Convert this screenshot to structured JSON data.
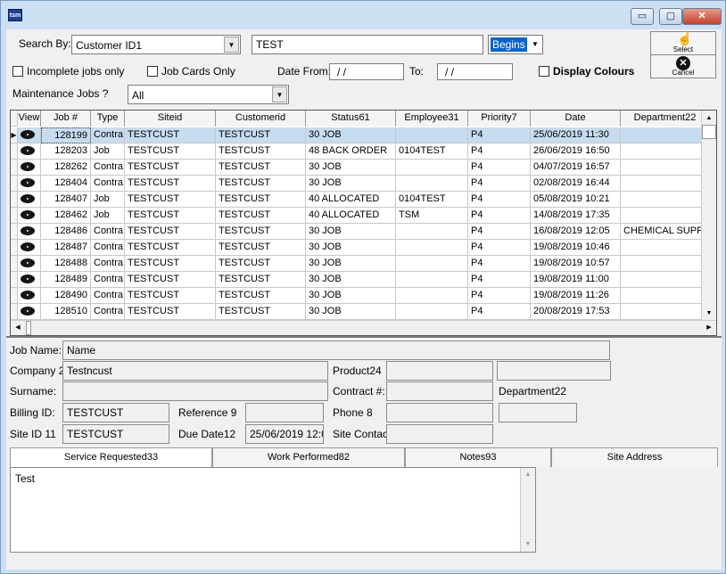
{
  "window": {
    "icon_text": "tsm",
    "minimize": "▭",
    "maximize": "▢",
    "close": "✕"
  },
  "search": {
    "by_label": "Search By:",
    "by_value": "Customer ID1",
    "term": "TEST",
    "mode": "Begins",
    "incomplete_label": "Incomplete jobs only",
    "jobcards_label": "Job Cards Only",
    "date_from_label": "Date From:",
    "date_from_value": "/  /",
    "to_label": "To:",
    "to_value": "/  /",
    "display_colours_label": "Display Colours",
    "maintenance_label": "Maintenance Jobs ?",
    "maintenance_value": "All",
    "select_label": "Select",
    "cancel_label": "Cancel"
  },
  "grid": {
    "columns": [
      "View",
      "Job #",
      "Type",
      "Siteid",
      "Customerid",
      "Status61",
      "Employee31",
      "Priority7",
      "Date",
      "Department22"
    ],
    "rows": [
      {
        "job": "128199",
        "type": "Contra",
        "siteid": "TESTCUST",
        "customerid": "TESTCUST",
        "status": "30 JOB",
        "employee": "",
        "priority": "P4",
        "date": "25/06/2019 11:30",
        "department": ""
      },
      {
        "job": "128203",
        "type": "Job",
        "siteid": "TESTCUST",
        "customerid": "TESTCUST",
        "status": "48 BACK ORDER",
        "employee": "0104TEST",
        "priority": "P4",
        "date": "26/06/2019 16:50",
        "department": ""
      },
      {
        "job": "128262",
        "type": "Contra",
        "siteid": "TESTCUST",
        "customerid": "TESTCUST",
        "status": "30 JOB",
        "employee": "",
        "priority": "P4",
        "date": "04/07/2019 16:57",
        "department": ""
      },
      {
        "job": "128404",
        "type": "Contra",
        "siteid": "TESTCUST",
        "customerid": "TESTCUST",
        "status": "30 JOB",
        "employee": "",
        "priority": "P4",
        "date": "02/08/2019 16:44",
        "department": ""
      },
      {
        "job": "128407",
        "type": "Job",
        "siteid": "TESTCUST",
        "customerid": "TESTCUST",
        "status": "40 ALLOCATED",
        "employee": "0104TEST",
        "priority": "P4",
        "date": "05/08/2019 10:21",
        "department": ""
      },
      {
        "job": "128462",
        "type": "Job",
        "siteid": "TESTCUST",
        "customerid": "TESTCUST",
        "status": "40 ALLOCATED",
        "employee": "TSM",
        "priority": "P4",
        "date": "14/08/2019 17:35",
        "department": ""
      },
      {
        "job": "128486",
        "type": "Contra",
        "siteid": "TESTCUST",
        "customerid": "TESTCUST",
        "status": "30 JOB",
        "employee": "",
        "priority": "P4",
        "date": "16/08/2019 12:05",
        "department": "CHEMICAL SUPP"
      },
      {
        "job": "128487",
        "type": "Contra",
        "siteid": "TESTCUST",
        "customerid": "TESTCUST",
        "status": "30 JOB",
        "employee": "",
        "priority": "P4",
        "date": "19/08/2019 10:46",
        "department": ""
      },
      {
        "job": "128488",
        "type": "Contra",
        "siteid": "TESTCUST",
        "customerid": "TESTCUST",
        "status": "30 JOB",
        "employee": "",
        "priority": "P4",
        "date": "19/08/2019 10:57",
        "department": ""
      },
      {
        "job": "128489",
        "type": "Contra",
        "siteid": "TESTCUST",
        "customerid": "TESTCUST",
        "status": "30 JOB",
        "employee": "",
        "priority": "P4",
        "date": "19/08/2019 11:00",
        "department": ""
      },
      {
        "job": "128490",
        "type": "Contra",
        "siteid": "TESTCUST",
        "customerid": "TESTCUST",
        "status": "30 JOB",
        "employee": "",
        "priority": "P4",
        "date": "19/08/2019 11:26",
        "department": ""
      },
      {
        "job": "128510",
        "type": "Contra",
        "siteid": "TESTCUST",
        "customerid": "TESTCUST",
        "status": "30 JOB",
        "employee": "",
        "priority": "P4",
        "date": "20/08/2019 17:53",
        "department": ""
      }
    ]
  },
  "detail": {
    "job_name_label": "Job Name:",
    "job_name_value": "Name",
    "company_label": "Company 2",
    "company_value": "Testncust",
    "product_label": "Product24",
    "product_value": "",
    "product_value2": "",
    "surname_label": "Surname:",
    "surname_value": "",
    "contract_label": "Contract #:",
    "contract_value": "",
    "department_label": "Department22",
    "billing_label": "Billing ID:",
    "billing_value": "TESTCUST",
    "reference_label": "Reference 9",
    "reference_value": "",
    "phone_label": "Phone 8",
    "phone_value": "",
    "phone_value2": "",
    "siteid_label": "Site ID 11",
    "siteid_value": "TESTCUST",
    "duedate_label": "Due Date12",
    "duedate_value": "25/06/2019 12:0",
    "sitecontact_label": "Site Contac",
    "sitecontact_value": ""
  },
  "tabs": [
    "Service Requested33",
    "Work Performed82",
    "Notes93",
    "Site Address"
  ],
  "memo": {
    "text": "Test"
  },
  "colors": {
    "titlebar": "#cde0f3",
    "selected_row": "#c7dcef",
    "mode_highlight": "#0a64c8"
  }
}
